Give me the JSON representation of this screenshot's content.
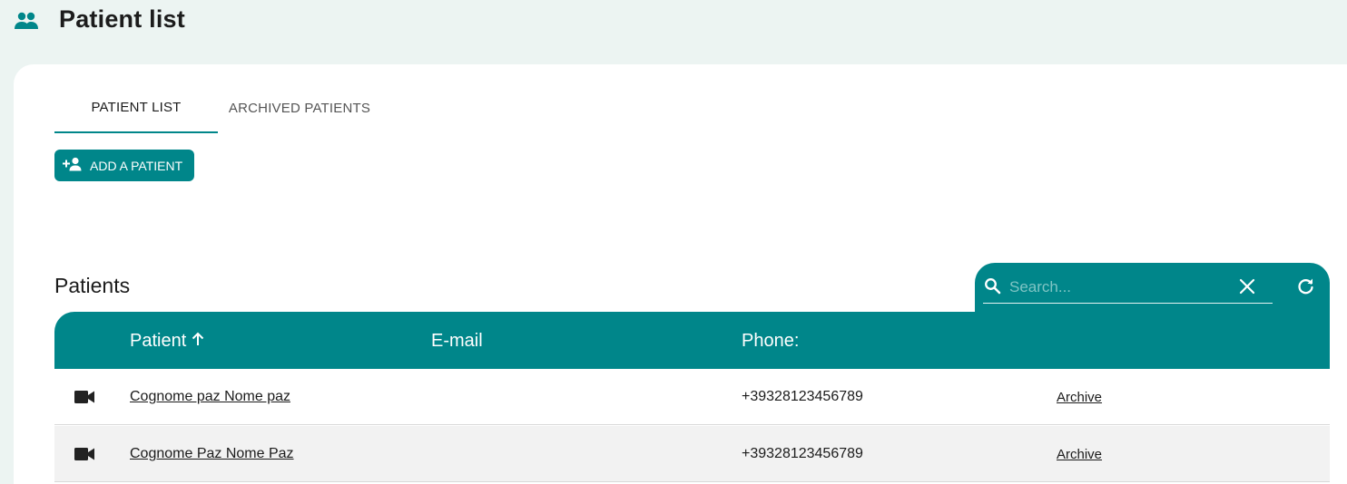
{
  "header": {
    "title": "Patient list",
    "icon": "people-icon"
  },
  "tabs": [
    {
      "label": "PATIENT LIST",
      "active": true
    },
    {
      "label": "ARCHIVED PATIENTS",
      "active": false
    }
  ],
  "add_button": {
    "label": "ADD A PATIENT",
    "icon": "person-add-icon"
  },
  "section": {
    "title": "Patients"
  },
  "search": {
    "placeholder": "Search...",
    "value": ""
  },
  "table": {
    "columns": {
      "patient": "Patient",
      "email": "E-mail",
      "phone": "Phone:"
    },
    "sort": {
      "column": "patient",
      "direction": "ascending"
    },
    "rows": [
      {
        "name": "Cognome paz Nome paz",
        "email": "",
        "phone": "+39328123456789",
        "action": "Archive"
      },
      {
        "name": "Cognome Paz Nome Paz",
        "email": "",
        "phone": "+39328123456789",
        "action": "Archive"
      }
    ]
  },
  "colors": {
    "accent": "#00868a",
    "background": "#ecf4f2",
    "row_alt": "#f2f2f2"
  }
}
